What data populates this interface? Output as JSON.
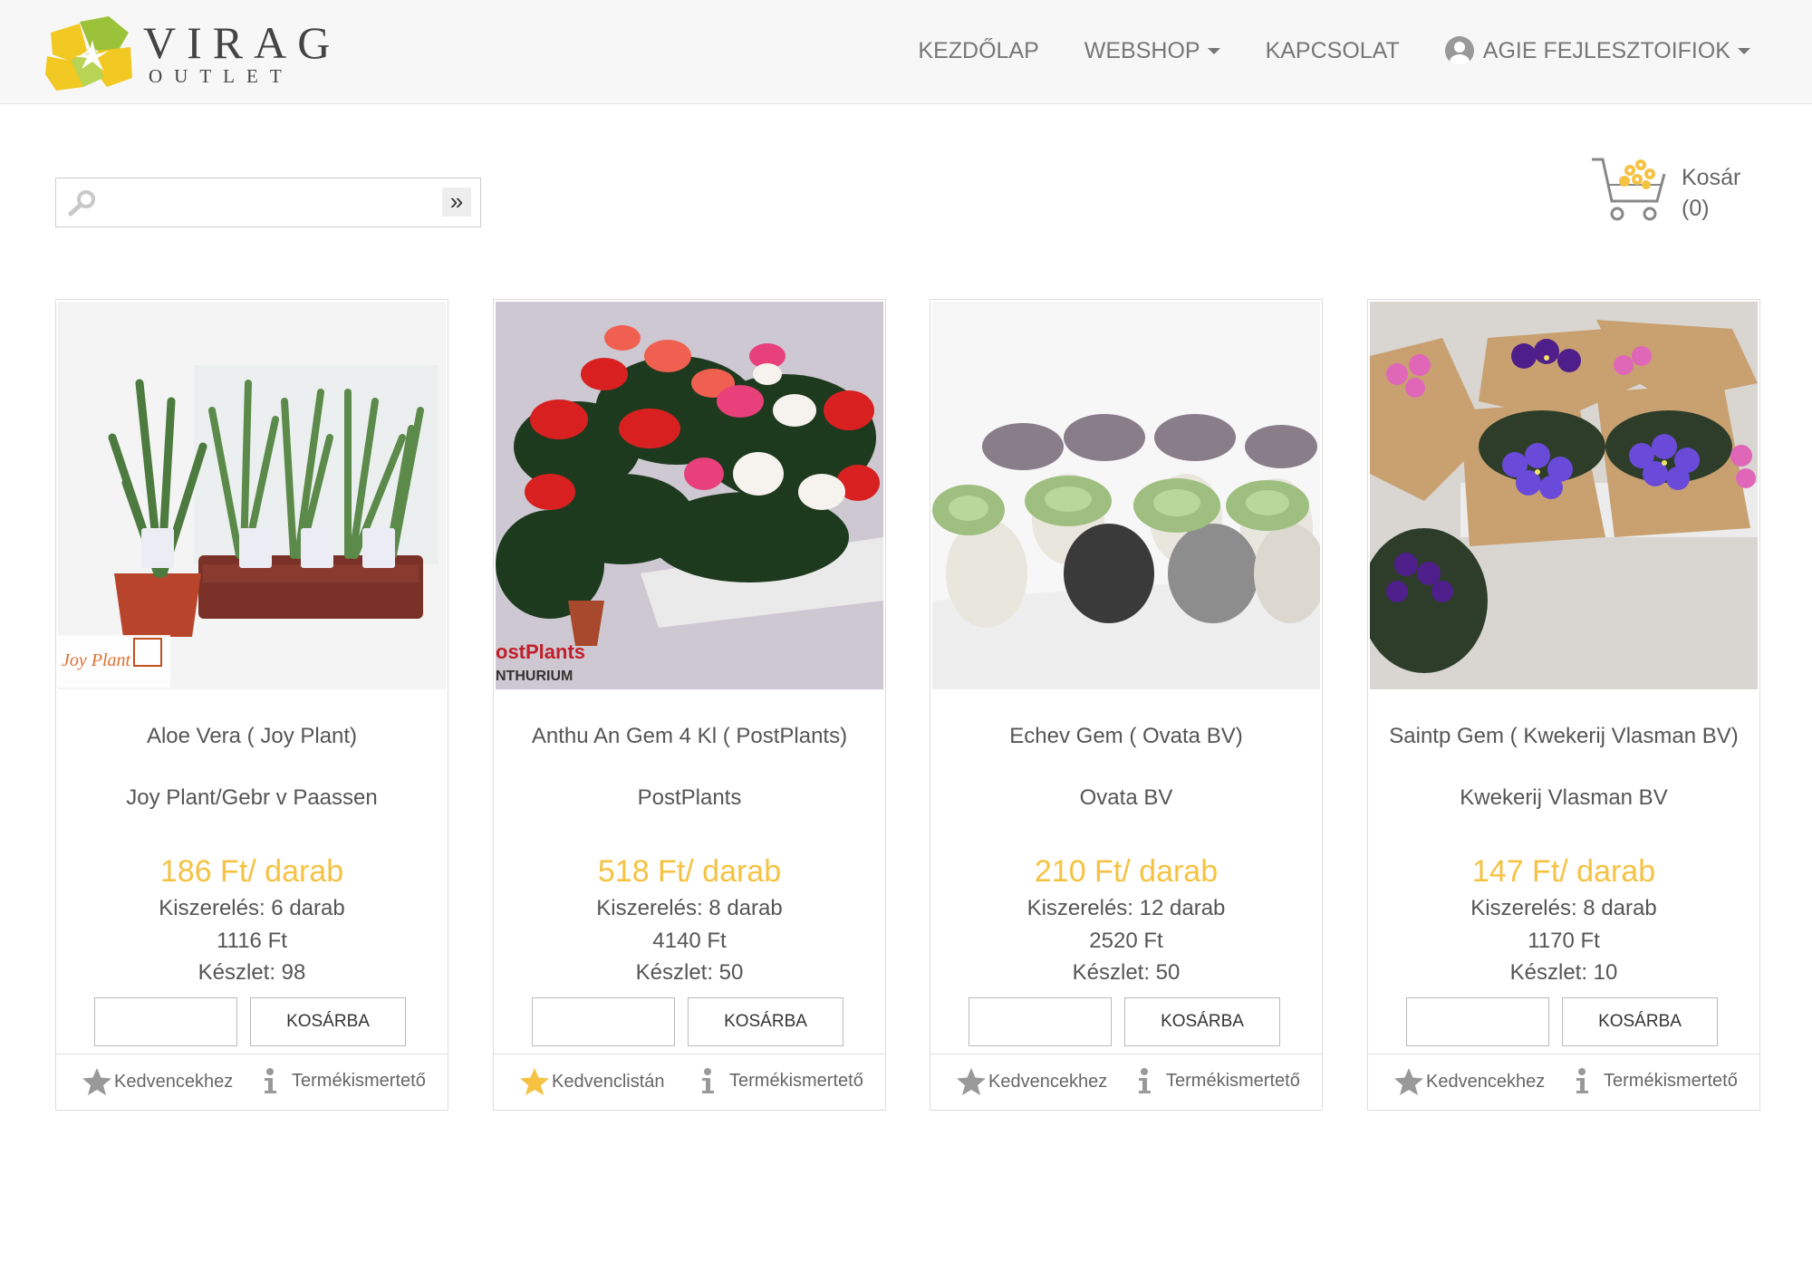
{
  "brand": {
    "name": "VIRAG",
    "sub": "OUTLET"
  },
  "nav": {
    "home": "KEZDŐLAP",
    "webshop": "WEBSHOP",
    "contact": "KAPCSOLAT",
    "account": "AGIE FEJLESZTOIFIOK"
  },
  "search": {
    "value": "",
    "go": "»"
  },
  "cart": {
    "label": "Kosár",
    "count": "(0)"
  },
  "colors": {
    "accent": "#f5c242",
    "star_active": "#f5c242",
    "star_inactive": "#999999"
  },
  "products": [
    {
      "name": "Aloe Vera ( Joy Plant)",
      "supplier": "Joy Plant/Gebr v Paassen",
      "price": "186 Ft/ darab",
      "pack": "Kiszerelés: 6 darab",
      "total": "1116 Ft",
      "stock": "Készlet: 98",
      "qty": "",
      "button": "KOSÁRBA",
      "fav": "Kedvencekhez",
      "fav_active": false,
      "info": "Termékismertető",
      "image_watermark": "Joy Plant"
    },
    {
      "name": "Anthu An Gem 4 Kl ( PostPlants)",
      "supplier": "PostPlants",
      "price": "518 Ft/ darab",
      "pack": "Kiszerelés: 8 darab",
      "total": "4140 Ft",
      "stock": "Készlet: 50",
      "qty": "",
      "button": "KOSÁRBA",
      "fav": "Kedvenclistán",
      "fav_active": true,
      "info": "Termékismertető",
      "image_watermark": "ostPlants",
      "image_watermark_2": "NTHURIUM"
    },
    {
      "name": "Echev Gem ( Ovata BV)",
      "supplier": "Ovata BV",
      "price": "210 Ft/ darab",
      "pack": "Kiszerelés: 12 darab",
      "total": "2520 Ft",
      "stock": "Készlet: 50",
      "qty": "",
      "button": "KOSÁRBA",
      "fav": "Kedvencekhez",
      "fav_active": false,
      "info": "Termékismertető"
    },
    {
      "name": "Saintp Gem ( Kwekerij Vlasman BV)",
      "supplier": "Kwekerij Vlasman BV",
      "price": "147 Ft/ darab",
      "pack": "Kiszerelés: 8 darab",
      "total": "1170 Ft",
      "stock": "Készlet: 10",
      "qty": "",
      "button": "KOSÁRBA",
      "fav": "Kedvencekhez",
      "fav_active": false,
      "info": "Termékismertető"
    }
  ]
}
